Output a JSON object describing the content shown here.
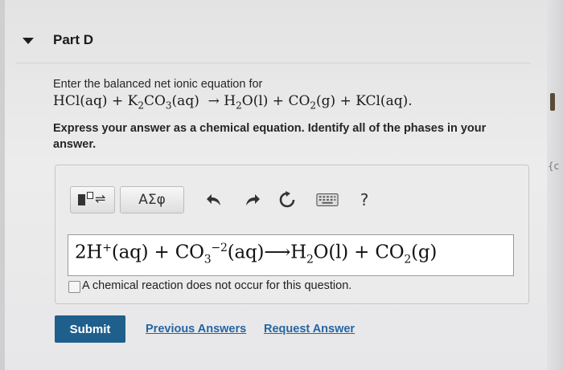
{
  "part": {
    "title": "Part D"
  },
  "question": {
    "prompt": "Enter the balanced net ionic equation for",
    "reaction": "HCl(aq) + K2CO3(aq) → H2O(l) + CO2(g) + KCl(aq).",
    "instructions": "Express your answer as a chemical equation. Identify all of the phases in your answer."
  },
  "toolbar": {
    "greek_label": "ΑΣφ",
    "help_label": "?",
    "icons": [
      "templates-icon",
      "undo-icon",
      "redo-icon",
      "reset-icon",
      "keyboard-icon",
      "help-icon"
    ]
  },
  "answer": {
    "equation": "2H+(aq) + CO3^-2(aq) → H2O(l) + CO2(g)"
  },
  "no_reaction_label": "A chemical reaction does not occur for this question.",
  "actions": {
    "submit": "Submit",
    "previous_answers": "Previous Answers",
    "request_answer": "Request Answer"
  },
  "colors": {
    "submit_bg": "#1f5f8c",
    "link": "#2565a3"
  }
}
